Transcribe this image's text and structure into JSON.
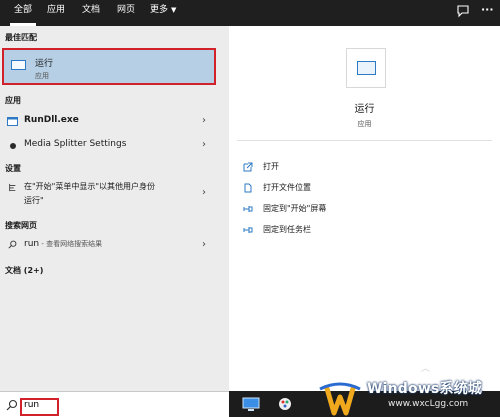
{
  "tabs": [
    {
      "label": "全部",
      "active": true
    },
    {
      "label": "应用"
    },
    {
      "label": "文档"
    },
    {
      "label": "网页"
    },
    {
      "label": "更多"
    }
  ],
  "sections": {
    "best_match": "最佳匹配",
    "apps": "应用",
    "settings": "设置",
    "web": "搜索网页",
    "docs": "文档 (2+)"
  },
  "best_match": {
    "title": "运行",
    "subtitle": "应用"
  },
  "apps": [
    {
      "label": "RunDll.exe"
    },
    {
      "label": "Media Splitter Settings"
    }
  ],
  "setting": {
    "line1": "在\"开始\"菜单中显示\"以其他用户身份",
    "line2": "运行\""
  },
  "web": {
    "query": "run",
    "suffix": " - 查看网络搜索结果"
  },
  "detail": {
    "title": "运行",
    "subtitle": "应用",
    "actions": [
      {
        "label": "打开",
        "icon": "open-icon"
      },
      {
        "label": "打开文件位置",
        "icon": "file-location-icon"
      },
      {
        "label": "固定到\"开始\"屏幕",
        "icon": "pin-icon"
      },
      {
        "label": "固定到任务栏",
        "icon": "pin-icon"
      }
    ]
  },
  "search": {
    "value": "run"
  },
  "watermark": {
    "main": "Windows系统城",
    "url": "www.wxcLgg.com"
  },
  "colors": {
    "highlight_border": "#d1222b",
    "selected_bg": "#b6cfe4",
    "topbar_bg": "#1f1f1f"
  }
}
